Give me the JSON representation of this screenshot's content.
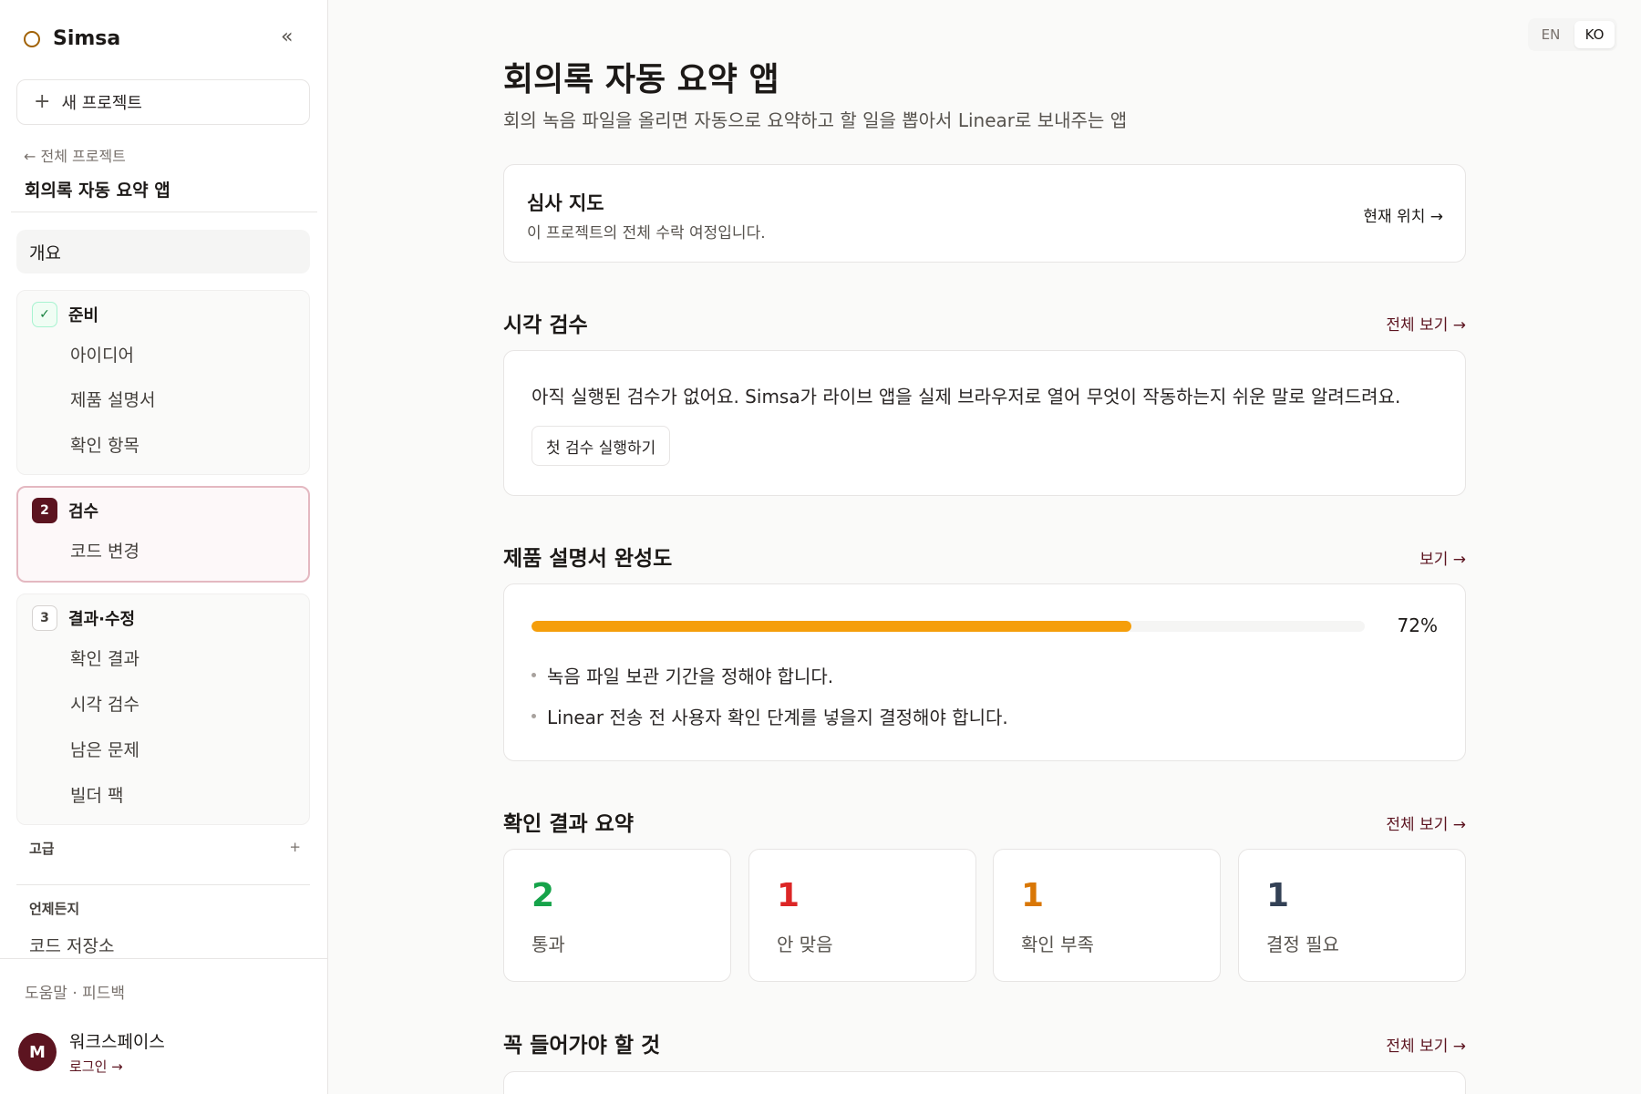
{
  "sidebar": {
    "brand": "Simsa",
    "collapse": "«",
    "new_project": "새 프로젝트",
    "back_link": "← 전체 프로젝트",
    "project_name": "회의록 자동 요약 앱",
    "overview": "개요",
    "groups": [
      {
        "badge": "✓",
        "title": "준비",
        "items": [
          "아이디어",
          "제품 설명서",
          "확인 항목"
        ]
      },
      {
        "badge": "2",
        "title": "검수",
        "items": [
          "코드 변경"
        ]
      },
      {
        "badge": "3",
        "title": "결과·수정",
        "items": [
          "확인 결과",
          "시각 검수",
          "남은 문제",
          "빌더 팩"
        ]
      }
    ],
    "advanced": "고급",
    "advanced_plus": "+",
    "anytime": "언제든지",
    "repo": "코드 저장소",
    "help": "도움말 · 피드백",
    "avatar": "M",
    "workspace": "워크스페이스",
    "login": "로그인 →"
  },
  "lang": {
    "en": "EN",
    "ko": "KO",
    "active": "KO"
  },
  "main": {
    "title": "회의록 자동 요약 앱",
    "subtitle": "회의 녹음 파일을 올리면 자동으로 요약하고 할 일을 뽑아서 Linear로 보내주는 앱",
    "review_map": {
      "title": "심사 지도",
      "desc": "이 프로젝트의 전체 수락 여정입니다.",
      "link": "현재 위치 →"
    },
    "visual": {
      "title": "시각 검수",
      "link": "전체 보기 →",
      "empty_text": "아직 실행된 검수가 없어요. Simsa가 라이브 앱을 실제 브라우저로 열어 무엇이 작동하는지 쉬운 말로 알려드려요.",
      "button": "첫 검수 실행하기"
    },
    "spec": {
      "title": "제품 설명서 완성도",
      "link": "보기 →",
      "progress": 72,
      "progress_label": "72%",
      "bullets": [
        "녹음 파일 보관 기간을 정해야 합니다.",
        "Linear 전송 전 사용자 확인 단계를 넣을지 결정해야 합니다."
      ]
    },
    "results": {
      "title": "확인 결과 요약",
      "link": "전체 보기 →",
      "stats": [
        {
          "value": "2",
          "label": "통과",
          "color": "#16a34a"
        },
        {
          "value": "1",
          "label": "안 맞음",
          "color": "#dc2626"
        },
        {
          "value": "1",
          "label": "확인 부족",
          "color": "#d97706"
        },
        {
          "value": "1",
          "label": "결정 필요",
          "color": "#334155"
        }
      ]
    },
    "must_have": {
      "title": "꼭 들어가야 할 것",
      "link": "전체 보기 →"
    }
  },
  "colors": {
    "accent": "#5c1420",
    "progress": "#f59e0b",
    "pass": "#16a34a",
    "mismatch": "#dc2626",
    "insufficient": "#d97706",
    "decision": "#334155"
  }
}
